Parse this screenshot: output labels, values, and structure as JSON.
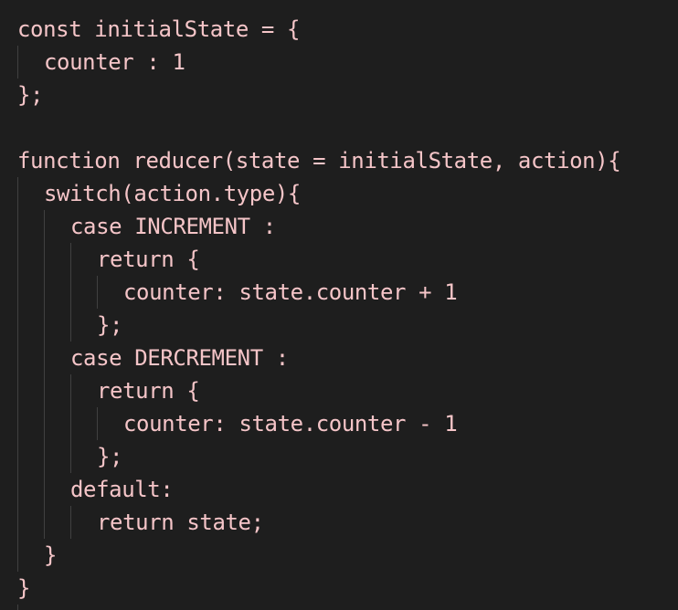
{
  "editor": {
    "background": "#1e1e1e",
    "text_color": "#f5c5c8",
    "indent_guide_color": "#404040",
    "lines": [
      {
        "text": "const initialState = {",
        "indent": 0
      },
      {
        "text": "counter : 1",
        "indent": 1
      },
      {
        "text": "};",
        "indent": 0
      },
      {
        "text": "",
        "indent": 0
      },
      {
        "text": "function reducer(state = initialState, action){",
        "indent": 0
      },
      {
        "text": "switch(action.type){",
        "indent": 1
      },
      {
        "text": "case INCREMENT :",
        "indent": 2
      },
      {
        "text": "return {",
        "indent": 3
      },
      {
        "text": "counter: state.counter + 1",
        "indent": 4
      },
      {
        "text": "};",
        "indent": 3
      },
      {
        "text": "case DERCREMENT :",
        "indent": 2
      },
      {
        "text": "return {",
        "indent": 3
      },
      {
        "text": "counter: state.counter - 1",
        "indent": 4
      },
      {
        "text": "};",
        "indent": 3
      },
      {
        "text": "default:",
        "indent": 2
      },
      {
        "text": "return state;",
        "indent": 3
      },
      {
        "text": "}",
        "indent": 1
      },
      {
        "text": "}",
        "indent": 0
      }
    ]
  }
}
